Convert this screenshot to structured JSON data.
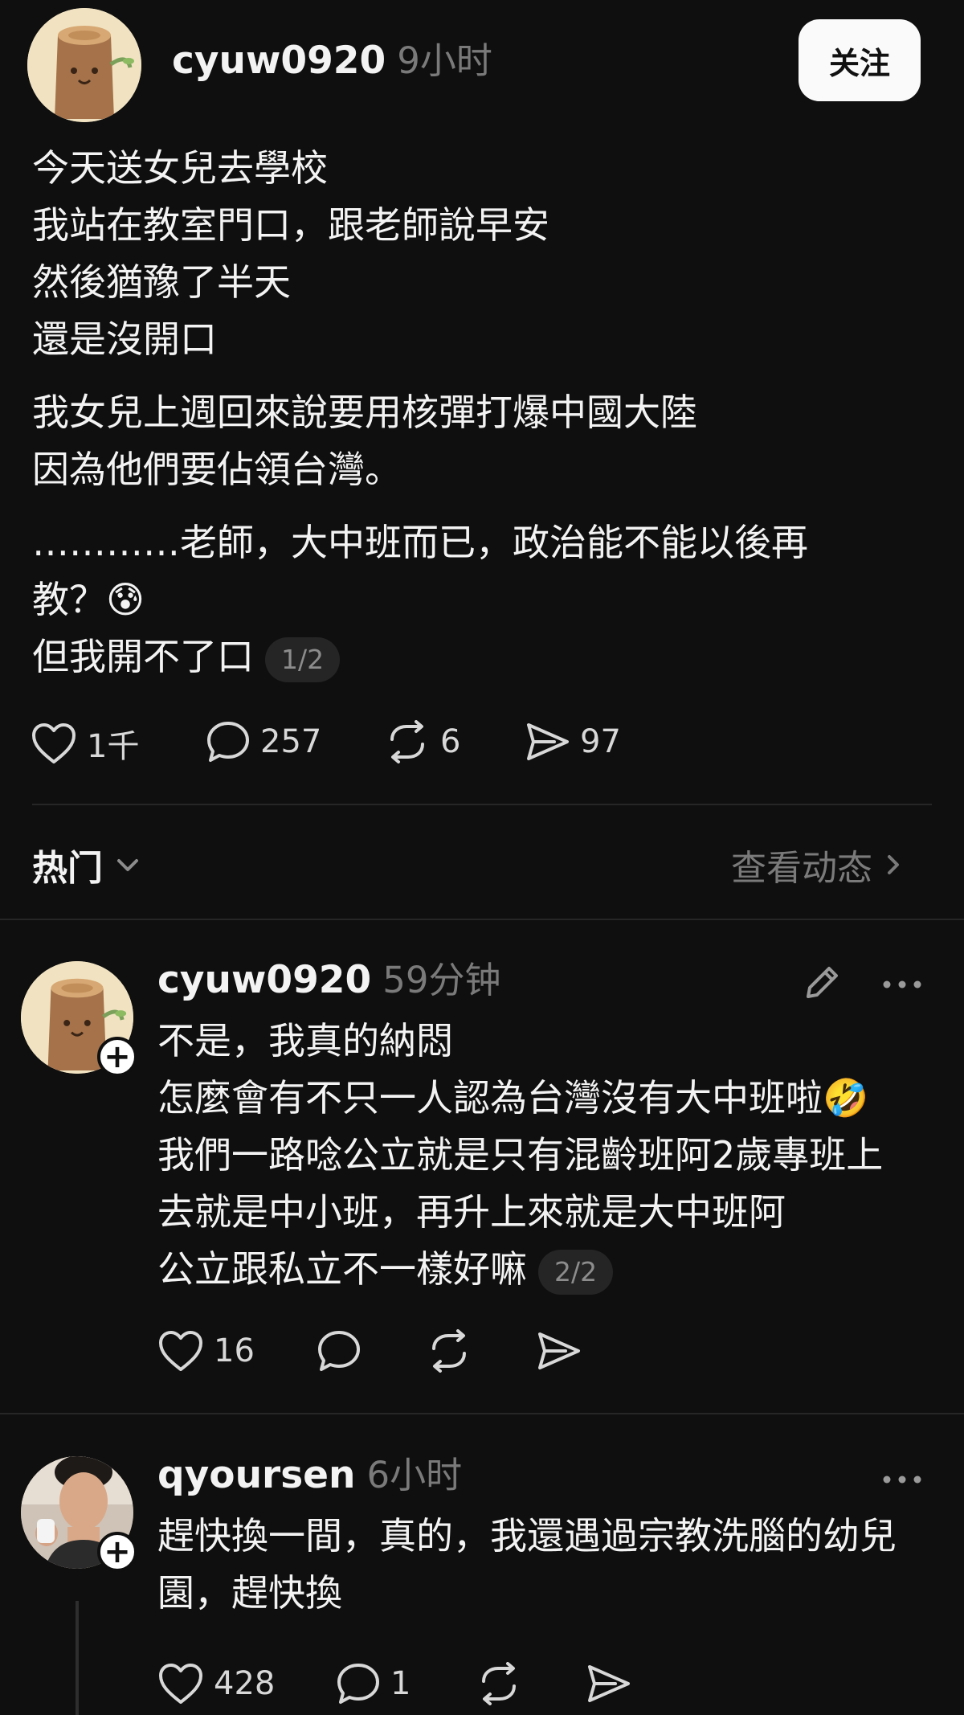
{
  "post": {
    "username": "cyuw0920",
    "time": "9小时",
    "follow_label": "关注",
    "lines_p1": [
      "今天送女兒去學校",
      "我站在教室門口，跟老師說早安",
      "然後猶豫了半天",
      "還是沒開口"
    ],
    "lines_p2": [
      "我女兒上週回來說要用核彈打爆中國大陸",
      "因為他們要佔領台灣。"
    ],
    "lines_p3_a": "…………老師，大中班而已，政治能不能以後再",
    "lines_p3_b": "教？😰",
    "lines_p3_c": "但我開不了口",
    "page_indicator": "1/2",
    "likes": "1千",
    "comments": "257",
    "reposts": "6",
    "shares": "97"
  },
  "sort_bar": {
    "sort_label": "热门",
    "activity_label": "查看动态"
  },
  "replies": [
    {
      "username": "cyuw0920",
      "time": "59分钟",
      "lines": [
        "不是，我真的納悶",
        "怎麼會有不只一人認為台灣沒有大中班啦🤣",
        "我們一路唸公立就是只有混齡班阿2歲專班上",
        "去就是中小班，再升上來就是大中班阿"
      ],
      "last_line": "公立跟私立不一樣好嘛",
      "page_indicator": "2/2",
      "likes": "16"
    },
    {
      "username": "qyoursen",
      "time": "6小时",
      "lines": [
        "趕快換一間，真的，我還遇過宗教洗腦的幼兒",
        "園，趕快換"
      ],
      "likes": "428",
      "comments": "1"
    }
  ],
  "colors": {
    "background": "#0f0f0f",
    "text": "#f3f3f3",
    "muted": "#7a7a7a"
  }
}
